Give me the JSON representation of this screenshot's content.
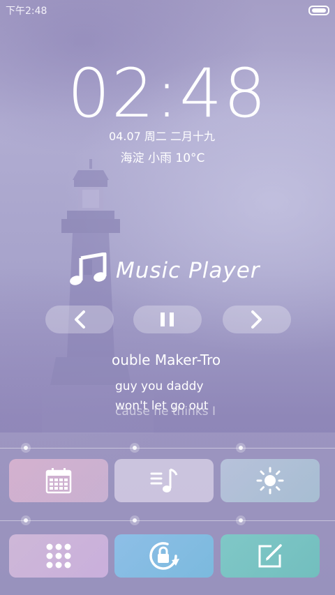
{
  "status_bar": {
    "time": "下午2:48",
    "battery_icon": "battery-icon"
  },
  "lockscreen": {
    "clock": {
      "hours": "02",
      "separator": ":",
      "minutes": "48"
    },
    "date": "04.07 周二 二月十九",
    "weather": "海淀 小雨 10°C"
  },
  "music_player": {
    "icon": "music-note-icon",
    "title": "Music Player",
    "controls": [
      {
        "name": "previous",
        "icon": "chevron-left-icon"
      },
      {
        "name": "pause",
        "icon": "pause-icon"
      },
      {
        "name": "next",
        "icon": "chevron-right-icon"
      }
    ],
    "song": "ouble Maker-Tro",
    "lyrics": [
      "guy you daddy",
      "won't let go out",
      "cause he thinks I"
    ]
  },
  "shortcuts": [
    {
      "name": "calendar",
      "icon": "calendar-icon",
      "color": "#d9b9cf"
    },
    {
      "name": "music",
      "icon": "music-list-icon",
      "color": "#cdc6de"
    },
    {
      "name": "brightness",
      "icon": "sun-icon",
      "color": "#b6c4d8"
    },
    {
      "name": "apps",
      "icon": "app-grid-icon",
      "color": "#d3b9dd"
    },
    {
      "name": "rotation-lock",
      "icon": "rotation-lock-icon",
      "color": "#7ec3e6"
    },
    {
      "name": "note",
      "icon": "edit-note-icon",
      "color": "#76c7c2"
    }
  ]
}
